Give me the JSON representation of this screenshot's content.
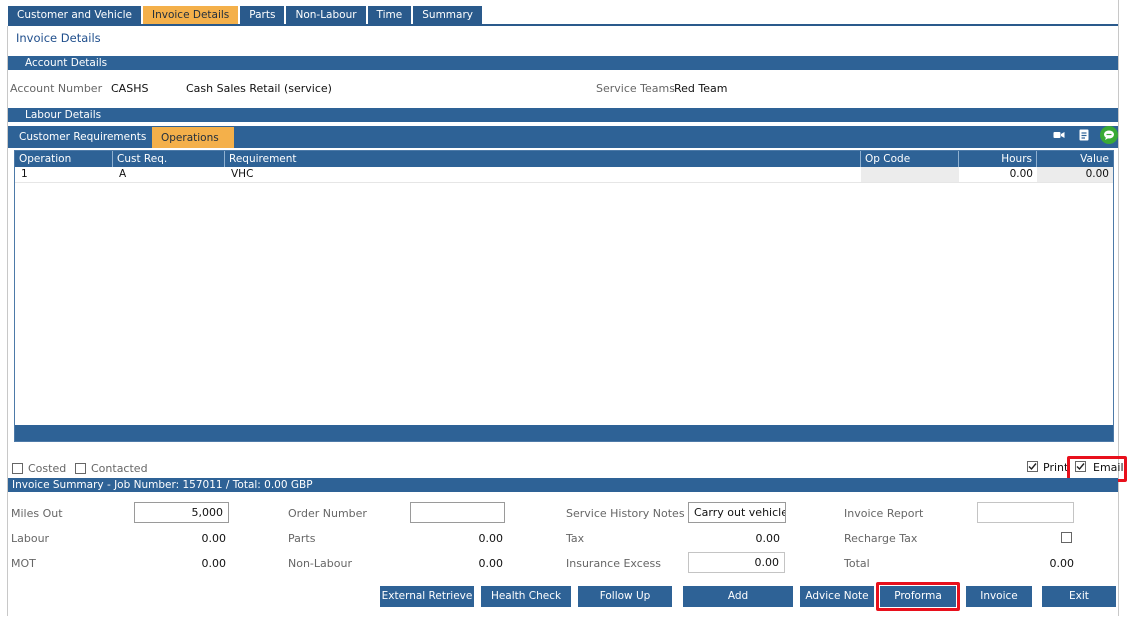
{
  "tabs": [
    "Customer and Vehicle",
    "Invoice Details",
    "Parts",
    "Non-Labour",
    "Time",
    "Summary"
  ],
  "active_tab": "Invoice Details",
  "page_title": "Invoice Details",
  "account": {
    "section_title": "Account Details",
    "account_number_label": "Account Number",
    "account_number": "CASHS",
    "account_name": "Cash Sales Retail (service)",
    "service_teams_label": "Service Teams",
    "service_teams": "Red Team"
  },
  "labour": {
    "section_title": "Labour Details",
    "subtabs": [
      "Customer Requirements",
      "Operations"
    ],
    "active_subtab": "Operations",
    "icons": [
      "video-icon",
      "notes-icon",
      "chat-icon"
    ],
    "columns": [
      "Operation",
      "Cust Req.",
      "Requirement",
      "Op Code",
      "Hours",
      "Value"
    ],
    "rows": [
      {
        "operation": "1",
        "cust_req": "A",
        "requirement": "VHC",
        "op_code": "",
        "hours": "0.00",
        "value": "0.00"
      }
    ]
  },
  "flags": {
    "costed": "Costed",
    "costed_checked": false,
    "contacted": "Contacted",
    "contacted_checked": false,
    "print": "Print",
    "print_checked": true,
    "email": "Email",
    "email_checked": true
  },
  "summary": {
    "title": "Invoice Summary - Job Number: 157011 / Total: 0.00 GBP",
    "miles_out_label": "Miles Out",
    "miles_out": "5,000",
    "labour_label": "Labour",
    "labour": "0.00",
    "mot_label": "MOT",
    "mot": "0.00",
    "order_number_label": "Order Number",
    "order_number": "",
    "parts_label": "Parts",
    "parts": "0.00",
    "non_labour_label": "Non-Labour",
    "non_labour": "0.00",
    "service_history_label": "Service History Notes",
    "service_history": "Carry out vehicle h",
    "tax_label": "Tax",
    "tax": "0.00",
    "insurance_excess_label": "Insurance Excess",
    "insurance_excess": "0.00",
    "invoice_report_label": "Invoice Report",
    "invoice_report": "",
    "recharge_tax_label": "Recharge Tax",
    "recharge_tax_checked": false,
    "total_label": "Total",
    "total": "0.00"
  },
  "buttons": {
    "external_retrieve": "External Retrieve",
    "health_check": "Health Check",
    "follow_up": "Follow Up",
    "add": "Add",
    "advice_note": "Advice Note",
    "proforma": "Proforma",
    "invoice": "Invoice",
    "exit": "Exit"
  },
  "colors": {
    "tab_bar": "#2a5a8c",
    "active_tab": "#f4b04a",
    "highlight": "#e8101c"
  }
}
